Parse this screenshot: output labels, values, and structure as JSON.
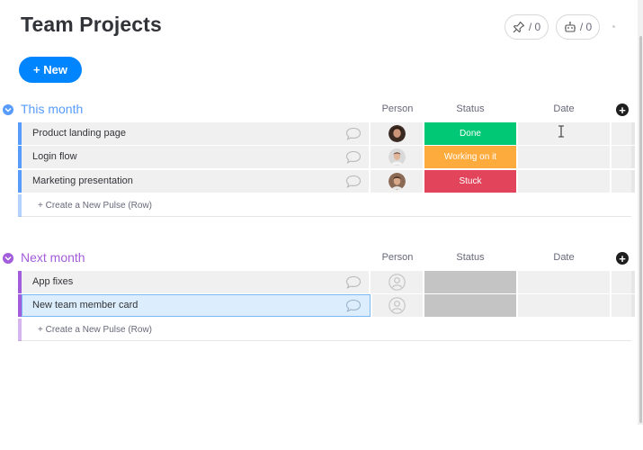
{
  "page_title": "Team Projects",
  "counters": [
    {
      "icon": "pin-icon",
      "value": "/ 0"
    },
    {
      "icon": "robot-icon",
      "value": "/ 0"
    }
  ],
  "new_button": "+ New",
  "columns": {
    "person": "Person",
    "status": "Status",
    "date": "Date"
  },
  "create_row_label": "+ Create a New Pulse (Row)",
  "groups": [
    {
      "title": "This month",
      "color": "#579bfc",
      "items": [
        {
          "name": "Product landing page",
          "person": "avatar-woman",
          "status": "Done",
          "status_color": "#00c875"
        },
        {
          "name": "Login flow",
          "person": "avatar-man",
          "status": "Working on it",
          "status_color": "#fdab3d"
        },
        {
          "name": "Marketing presentation",
          "person": "avatar-man-2",
          "status": "Stuck",
          "status_color": "#e2445c"
        }
      ]
    },
    {
      "title": "Next month",
      "color": "#a25ddc",
      "items": [
        {
          "name": "App fixes",
          "person": "empty",
          "status": "",
          "status_color": "#c4c4c4"
        },
        {
          "name": "New team member card",
          "person": "empty",
          "status": "",
          "status_color": "#c4c4c4",
          "selected": true
        }
      ]
    }
  ]
}
